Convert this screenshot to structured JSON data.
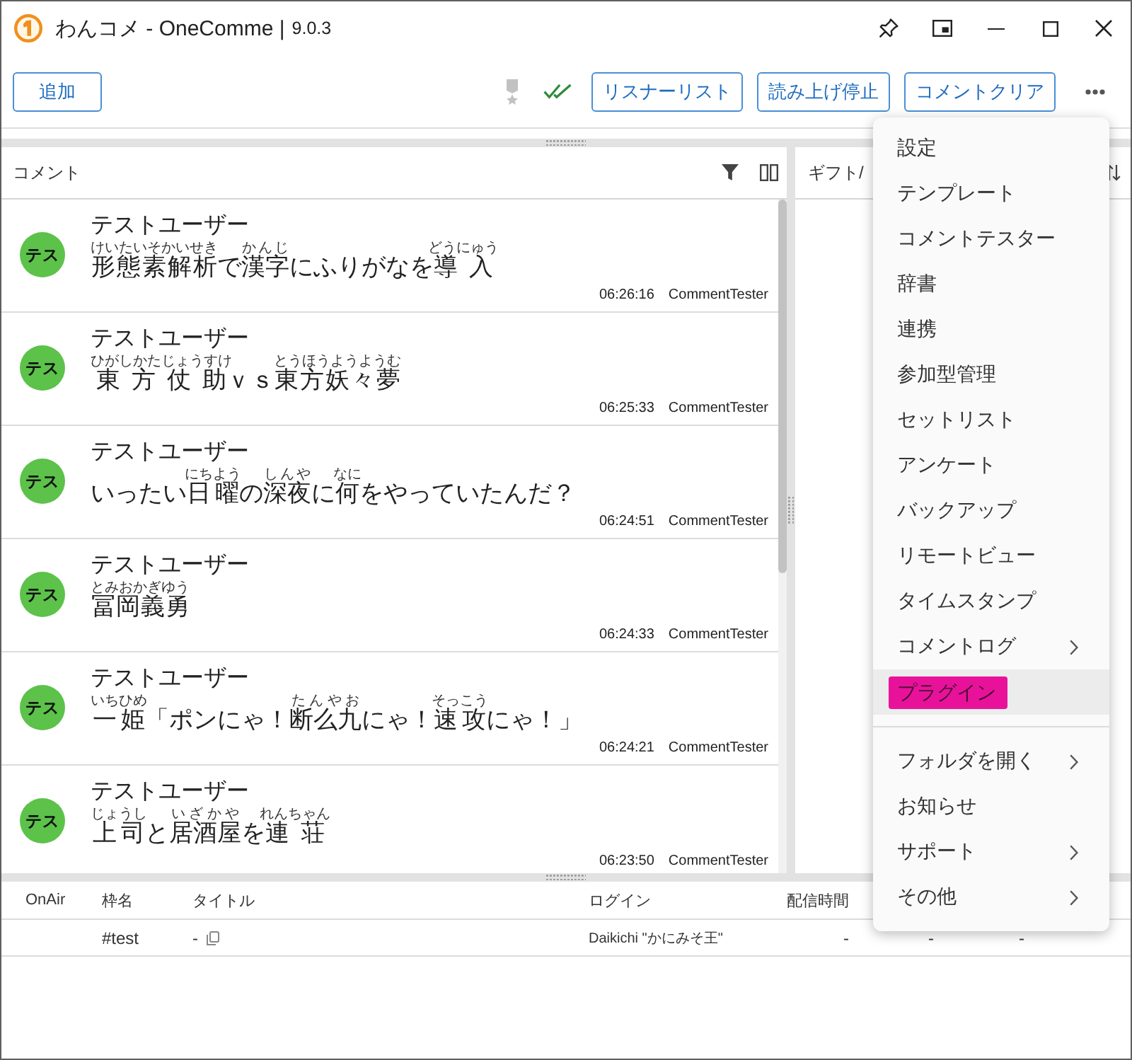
{
  "window": {
    "title": "わんコメ - OneComme |",
    "version": "9.0.3"
  },
  "toolbar": {
    "add_button": "追加",
    "buttons": [
      "リスナーリスト",
      "読み上げ停止",
      "コメントクリア"
    ]
  },
  "comment_panel": {
    "title": "コメント",
    "comments": [
      {
        "name": "テストユーザー",
        "avatar": "テス",
        "segments": [
          {
            "text": "形態素解析",
            "ruby": "けいたいそかいせき"
          },
          {
            "text": "で"
          },
          {
            "text": "漢字",
            "ruby": "かんじ"
          },
          {
            "text": "にふりがなを"
          },
          {
            "text": "導入",
            "ruby": "どうにゅう"
          }
        ],
        "time": "06:26:16",
        "source": "CommentTester"
      },
      {
        "name": "テストユーザー",
        "avatar": "テス",
        "segments": [
          {
            "text": "東方仗助",
            "ruby": "ひがしかたじょうすけ"
          },
          {
            "text": "ｖｓ"
          },
          {
            "text": "東方妖々夢",
            "ruby": "とうほうようようむ"
          }
        ],
        "time": "06:25:33",
        "source": "CommentTester"
      },
      {
        "name": "テストユーザー",
        "avatar": "テス",
        "segments": [
          {
            "text": "いったい"
          },
          {
            "text": "日曜",
            "ruby": "にちよう"
          },
          {
            "text": "の"
          },
          {
            "text": "深夜",
            "ruby": "しんや"
          },
          {
            "text": "に"
          },
          {
            "text": "何",
            "ruby": "なに"
          },
          {
            "text": "をやっていたんだ？"
          }
        ],
        "time": "06:24:51",
        "source": "CommentTester"
      },
      {
        "name": "テストユーザー",
        "avatar": "テス",
        "segments": [
          {
            "text": "冨岡義勇",
            "ruby": "とみおかぎゆう"
          }
        ],
        "time": "06:24:33",
        "source": "CommentTester"
      },
      {
        "name": "テストユーザー",
        "avatar": "テス",
        "segments": [
          {
            "text": "一姫",
            "ruby": "いちひめ"
          },
          {
            "text": "「ポンにゃ！"
          },
          {
            "text": "断么九",
            "ruby": "たんやお"
          },
          {
            "text": "にゃ！"
          },
          {
            "text": "速攻",
            "ruby": "そっこう"
          },
          {
            "text": "にゃ！」"
          }
        ],
        "time": "06:24:21",
        "source": "CommentTester"
      },
      {
        "name": "テストユーザー",
        "avatar": "テス",
        "segments": [
          {
            "text": "上司",
            "ruby": "じょうし"
          },
          {
            "text": "と"
          },
          {
            "text": "居酒屋",
            "ruby": "いざかや"
          },
          {
            "text": "を"
          },
          {
            "text": "連荘",
            "ruby": "れんちゃん"
          }
        ],
        "time": "06:23:50",
        "source": "CommentTester"
      }
    ]
  },
  "gift_panel": {
    "title": "ギフト/"
  },
  "stream_table": {
    "columns": [
      "OnAir",
      "枠名",
      "タイトル",
      "ログイン",
      "配信時間"
    ],
    "rows": [
      {
        "frame": "#test",
        "title": "-",
        "login": "Daikichi \"かにみそ王\"",
        "duration": "-",
        "column_6": "-",
        "column_7": "-"
      }
    ]
  },
  "menu": {
    "groups": [
      [
        {
          "label": "設定",
          "submenu": false,
          "hovered": false,
          "highlighted": false
        },
        {
          "label": "テンプレート",
          "submenu": false,
          "hovered": false,
          "highlighted": false
        },
        {
          "label": "コメントテスター",
          "submenu": false,
          "hovered": false,
          "highlighted": false
        },
        {
          "label": "辞書",
          "submenu": false,
          "hovered": false,
          "highlighted": false
        },
        {
          "label": "連携",
          "submenu": false,
          "hovered": false,
          "highlighted": false
        },
        {
          "label": "参加型管理",
          "submenu": false,
          "hovered": false,
          "highlighted": false
        },
        {
          "label": "セットリスト",
          "submenu": false,
          "hovered": false,
          "highlighted": false
        },
        {
          "label": "アンケート",
          "submenu": false,
          "hovered": false,
          "highlighted": false
        },
        {
          "label": "バックアップ",
          "submenu": false,
          "hovered": false,
          "highlighted": false
        },
        {
          "label": "リモートビュー",
          "submenu": false,
          "hovered": false,
          "highlighted": false
        },
        {
          "label": "タイムスタンプ",
          "submenu": false,
          "hovered": false,
          "highlighted": false
        },
        {
          "label": "コメントログ",
          "submenu": true,
          "hovered": false,
          "highlighted": false
        },
        {
          "label": "プラグイン",
          "submenu": false,
          "hovered": true,
          "highlighted": true
        }
      ],
      [
        {
          "label": "フォルダを開く",
          "submenu": true,
          "hovered": false,
          "highlighted": false
        },
        {
          "label": "お知らせ",
          "submenu": false,
          "hovered": false,
          "highlighted": false
        },
        {
          "label": "サポート",
          "submenu": true,
          "hovered": false,
          "highlighted": false
        },
        {
          "label": "その他",
          "submenu": true,
          "hovered": false,
          "highlighted": false
        }
      ]
    ]
  }
}
